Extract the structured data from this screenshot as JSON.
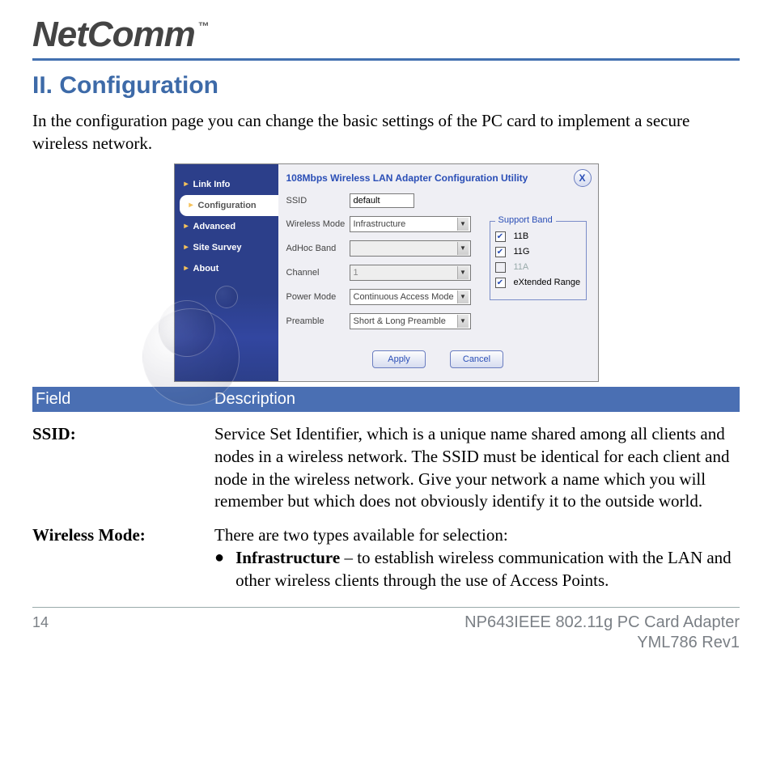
{
  "brand": "NetComm",
  "brand_tm": "™",
  "heading": "II. Configuration",
  "intro": "In the configuration page you can change the basic settings of the PC card to implement a secure wireless network.",
  "shot": {
    "nav": {
      "linkinfo": "Link Info",
      "configuration": "Configuration",
      "advanced": "Advanced",
      "sitesurvey": "Site Survey",
      "about": "About"
    },
    "title": "108Mbps Wireless LAN Adapter Configuration Utility",
    "close": "X",
    "fields": {
      "ssid_label": "SSID",
      "ssid_value": "default",
      "wmode_label": "Wireless Mode",
      "wmode_value": "Infrastructure",
      "adhoc_label": "AdHoc Band",
      "adhoc_value": "",
      "channel_label": "Channel",
      "channel_value": "1",
      "power_label": "Power Mode",
      "power_value": "Continuous Access Mode",
      "preamble_label": "Preamble",
      "preamble_value": "Short & Long Preamble"
    },
    "support": {
      "legend": "Support Band",
      "b": "11B",
      "g": "11G",
      "a": "11A",
      "x": "eXtended Range"
    },
    "buttons": {
      "apply": "Apply",
      "cancel": "Cancel"
    }
  },
  "table": {
    "head_field": "Field",
    "head_desc": "Description",
    "rows": {
      "ssid_name": "SSID:",
      "ssid_desc": "Service Set Identifier, which is a unique name shared among all clients and nodes in a wireless network. The SSID must be identical for each client and node in the wireless network.  Give your network a name which you will remember but which does not obviously identify it to the outside world.",
      "wmode_name": "Wireless Mode:",
      "wmode_desc_lead": "There are two types available for selection:",
      "wmode_bullet_name": "Infrastructure",
      "wmode_bullet_rest": " – to establish wireless communication with the LAN and other wireless clients through the use of Access Points."
    }
  },
  "footer": {
    "page_no": "14",
    "line1": "NP643IEEE 802.11g PC Card Adapter",
    "line2": "YML786 Rev1"
  }
}
